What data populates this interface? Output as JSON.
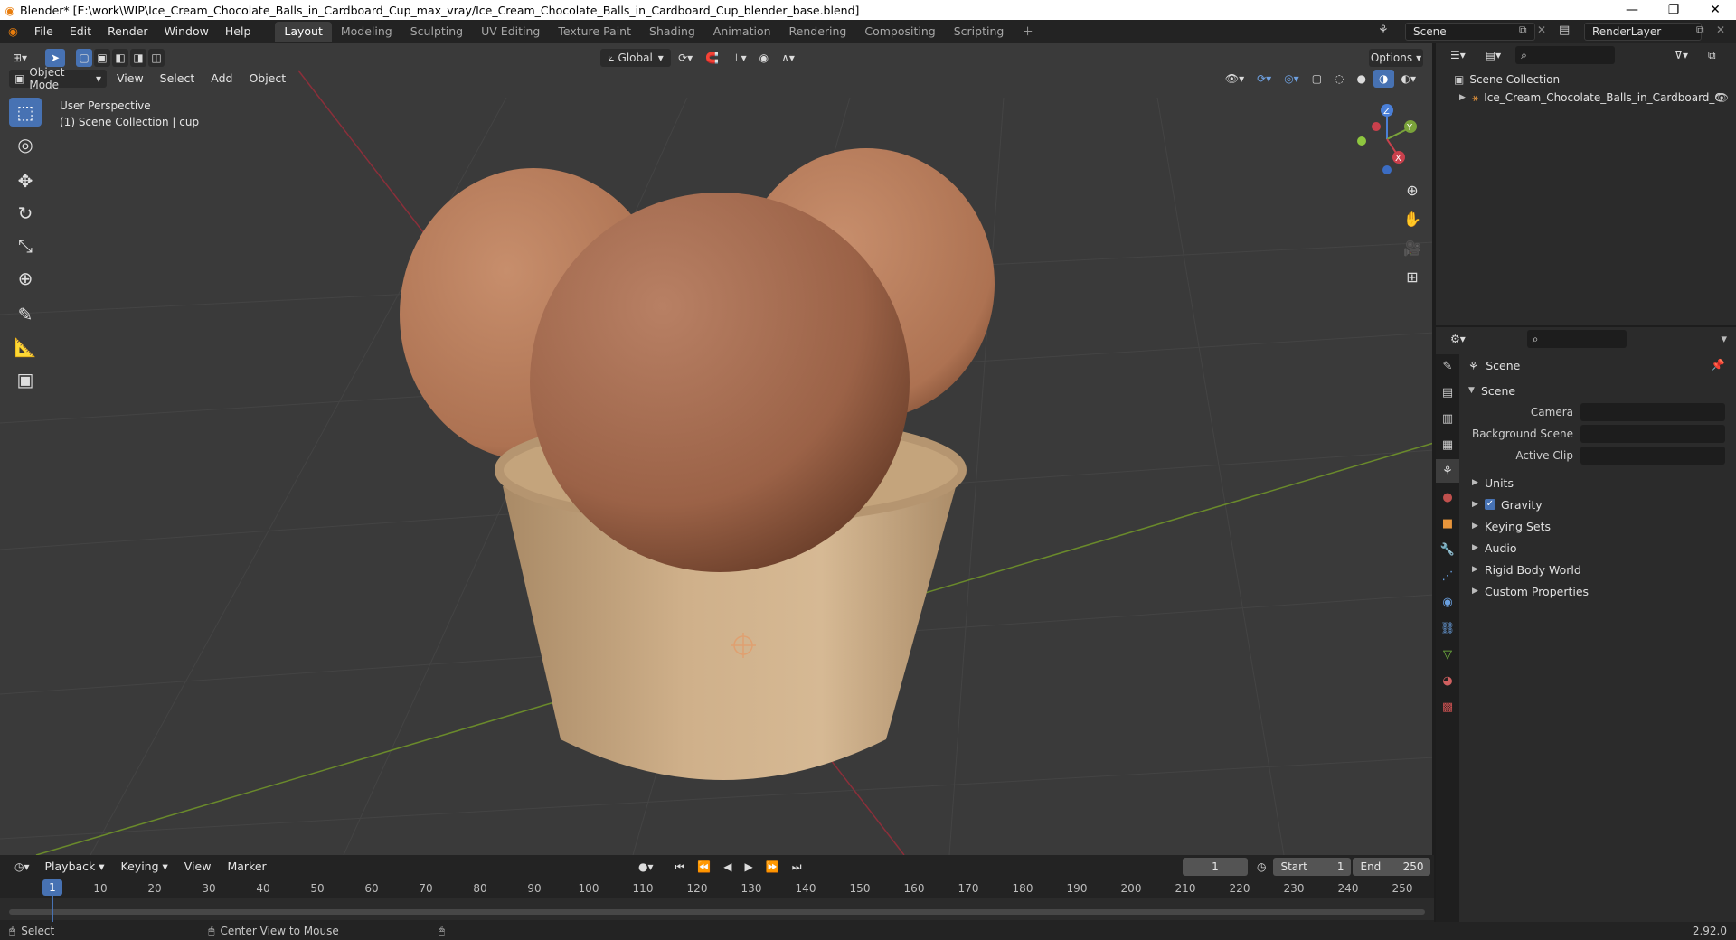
{
  "window": {
    "title": "Blender* [E:\\work\\WIP\\Ice_Cream_Chocolate_Balls_in_Cardboard_Cup_max_vray/Ice_Cream_Chocolate_Balls_in_Cardboard_Cup_blender_base.blend]",
    "logo": "blender-logo"
  },
  "menus": [
    "File",
    "Edit",
    "Render",
    "Window",
    "Help"
  ],
  "workspaces": [
    {
      "label": "Layout",
      "active": true
    },
    {
      "label": "Modeling"
    },
    {
      "label": "Sculpting"
    },
    {
      "label": "UV Editing"
    },
    {
      "label": "Texture Paint"
    },
    {
      "label": "Shading"
    },
    {
      "label": "Animation"
    },
    {
      "label": "Rendering"
    },
    {
      "label": "Compositing"
    },
    {
      "label": "Scripting"
    }
  ],
  "scene_name": "Scene",
  "render_layer": "RenderLayer",
  "viewport": {
    "mode": "Object Mode",
    "menu": [
      "View",
      "Select",
      "Add",
      "Object"
    ],
    "orientation": "Global",
    "options": "Options",
    "perspective": "User Perspective",
    "collection_info": "(1) Scene Collection | cup",
    "gizmo_axes": [
      "Z",
      "Y",
      "X"
    ],
    "colors": {
      "x_axis": "#8b2f3a",
      "y_axis": "#6a8a2b",
      "cup": "#c9a77e",
      "scoop": "#a86a4d"
    }
  },
  "outliner": {
    "root": "Scene Collection",
    "item": "Ice_Cream_Chocolate_Balls_in_Cardboard_C"
  },
  "properties": {
    "context": "Scene",
    "panel": "Scene",
    "fields": [
      {
        "label": "Camera"
      },
      {
        "label": "Background Scene"
      },
      {
        "label": "Active Clip"
      }
    ],
    "subpanels": [
      {
        "label": "Units",
        "checked": null
      },
      {
        "label": "Gravity",
        "checked": true
      },
      {
        "label": "Keying Sets",
        "checked": null
      },
      {
        "label": "Audio",
        "checked": null
      },
      {
        "label": "Rigid Body World",
        "checked": null
      },
      {
        "label": "Custom Properties",
        "checked": null
      }
    ]
  },
  "timeline": {
    "menu": [
      "Playback",
      "Keying",
      "View",
      "Marker"
    ],
    "current_frame": "1",
    "start_label": "Start",
    "start": "1",
    "end_label": "End",
    "end": "250",
    "ticks": [
      "1",
      "10",
      "20",
      "30",
      "40",
      "50",
      "60",
      "70",
      "80",
      "90",
      "100",
      "110",
      "120",
      "130",
      "140",
      "150",
      "160",
      "170",
      "180",
      "190",
      "200",
      "210",
      "220",
      "230",
      "240",
      "250"
    ]
  },
  "statusbar": {
    "select": "Select",
    "center": "Center View to Mouse",
    "version": "2.92.0"
  }
}
